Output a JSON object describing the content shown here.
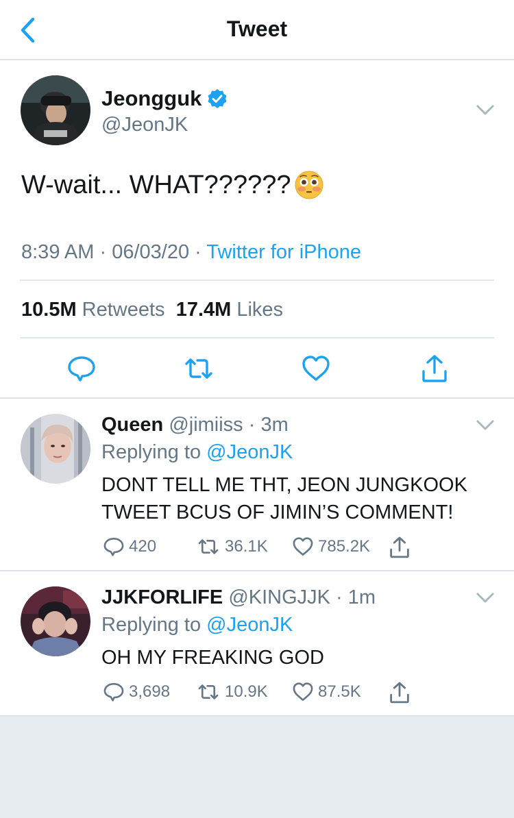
{
  "header": {
    "title": "Tweet",
    "back_icon": "chevron-left-icon"
  },
  "colors": {
    "accent": "#1da1f2",
    "secondary_text": "#657786",
    "background": "#e6ecf0"
  },
  "main_tweet": {
    "name": "Jeongguk",
    "handle": "@JeonJK",
    "verified": true,
    "text": "W-wait... WHAT??????",
    "emoji": "flushed-face",
    "time": "8:39 AM",
    "date": "06/03/20",
    "source": "Twitter for iPhone",
    "retweets_count": "10.5M",
    "retweets_label": "Retweets",
    "likes_count": "17.4M",
    "likes_label": "Likes"
  },
  "replies": [
    {
      "name": "Queen",
      "handle": "@jimiiss",
      "time": "3m",
      "replying_label": "Replying to",
      "replying_to": "@JeonJK",
      "text": "DONT TELL ME THT, JEON JUNGKOOK TWEET BCUS OF JIMIN’S COMMENT!",
      "reply_count": "420",
      "retweet_count": "36.1K",
      "like_count": "785.2K"
    },
    {
      "name": "JJKFORLIFE",
      "handle": "@KINGJJK",
      "time": "1m",
      "replying_label": "Replying to",
      "replying_to": "@JeonJK",
      "text": "OH MY FREAKING GOD",
      "reply_count": "3,698",
      "retweet_count": "10.9K",
      "like_count": "87.5K"
    }
  ],
  "separator": "·"
}
